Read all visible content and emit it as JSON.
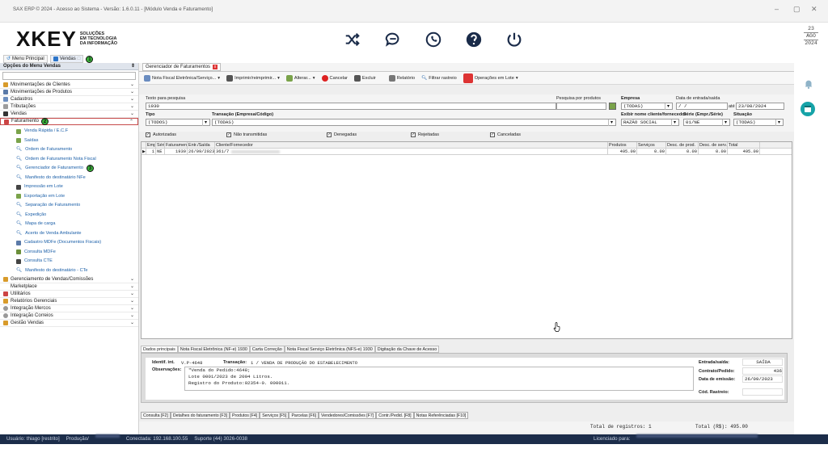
{
  "window": {
    "title": "SAX ERP © 2024 - Acesso ao Sistema - Versão: 1.6.0.11 - [Módulo Venda e Faturamento]",
    "controls": [
      "–",
      "▢",
      "✕"
    ]
  },
  "logo": {
    "mark": "XKEY",
    "tag_line1": "SOLUÇÕES",
    "tag_line2": "EM TECNOLOGIA",
    "tag_line3": "DA INFORMAÇÃO"
  },
  "header_icons": [
    "shuffle-icon",
    "chat-icon",
    "whatsapp-icon",
    "help-icon",
    "power-icon"
  ],
  "date": {
    "day": "23",
    "month": "AGO",
    "year": "2024"
  },
  "tabs": {
    "main_menu": "Menu Principal",
    "vendas": "Vendas",
    "badge": "1"
  },
  "sidebar": {
    "title": "Opções do Menu Vendas",
    "items": [
      {
        "label": "Movimentações de Clientes"
      },
      {
        "label": "Movimentações de Produtos"
      },
      {
        "label": "Cadastros"
      },
      {
        "label": "Tributações"
      },
      {
        "label": "Vendas"
      },
      {
        "label": "Faturamento",
        "badge": "2"
      }
    ],
    "subitems": [
      "Venda Rápida / E.C.F",
      "Saídas",
      "Ordem de Faturamento",
      "Ordem de Faturamento Nota Fiscal",
      "Gerenciador de Faturamento",
      "Manifesto do destinatário NFe",
      "Impressão em Lote",
      "Exportação em Lote",
      "Separação de Faturamento",
      "Expedição",
      "Mapa de carga",
      "Acerto de Venda Ambulante",
      "Cadastro MDFe (Documentos Fiscais)",
      "Consulta MDFe",
      "Consulta CTE",
      "Manifesto do destinatário - CTe"
    ],
    "sub_badge": "3",
    "items_after": [
      "Gerenciamento de Vendas/Comissões",
      "Marketplace",
      "Utilitários",
      "Relatórios Gerenciais",
      "Integração Mercos",
      "Integração Correios",
      "Gestão Vendas"
    ]
  },
  "main_tab": "Gerenciador de Faturamentos",
  "toolbar": {
    "nfe": "Nota Fiscal Eletrônica/Serviço...",
    "print": "Imprimir/reimprimir...",
    "alter": "Alterar...",
    "cancel": "Cancelar",
    "delete": "Excluir",
    "report": "Relatório",
    "filter": "Filtrar rastreio",
    "batch": "Operações em Lote"
  },
  "form": {
    "search_label": "Texto para pesquisa",
    "search_value": "1930",
    "product_label": "Pesquisa por produtos",
    "company_label": "Empresa",
    "company_value": "(TODAS)",
    "date_label": "Data de entrada/saída",
    "date_from": "/ /",
    "date_to_label": "até",
    "date_to": "23/08/2024",
    "type_label": "Tipo",
    "type_value": "(TODOS)",
    "transaction_label": "Transação (Empresa/Código)",
    "transaction_value": "(TODAS)",
    "show_name_label": "Exibir nome cliente/fornecedor",
    "show_name_value": "RAZÃO SOCIAL",
    "series_label": "Série (Empr./Série)",
    "series_value": "01/NE",
    "status_label": "Situação",
    "status_value": "(TODAS)",
    "checks": [
      {
        "label": "Autorizadas",
        "checked": "✓"
      },
      {
        "label": "Não transmitidas",
        "checked": "✓"
      },
      {
        "label": "Denegadas",
        "checked": "✓"
      },
      {
        "label": "Rejeitadas",
        "checked": "✓"
      },
      {
        "label": "Canceladas",
        "checked": "✓"
      }
    ]
  },
  "grid": {
    "headers": [
      "Emp.",
      "Série",
      "Faturamento",
      "Entr./Saída",
      "Cliente/Fornecedor",
      "Produtos",
      "Serviços",
      "Desc. de prod.",
      "Desc. de serv.",
      "Total"
    ],
    "row": {
      "emp": "1",
      "serie": "NE",
      "fat": "1930",
      "date": "26/09/2023",
      "client": "361/7",
      "produtos": "495.00",
      "servicos": "0.00",
      "descp": "0.00",
      "descs": "0.00",
      "total": "495.00"
    }
  },
  "detail_tabs": [
    "Dados principais",
    "Nota Fiscal Eletrônica (NF-e) 1930",
    "Carta Correção",
    "Nota Fiscal Serviço Eletrônica (NFS-e) 1930",
    "Digitação da Chave de Acesso"
  ],
  "details": {
    "ident_label": "Identif. int.",
    "ident_value": "V.P-4648",
    "trans_label": "Transação:",
    "trans_value": "1 / VENDA DE PRODUÇÃO DO ESTABELECIMENTO",
    "obs_label": "Observações:",
    "obs_line1": "\"Venda do Pedido:4648;",
    "obs_line2": "Lote 0001/2023 de 2004 Litros.",
    "obs_line3": "Registro do Produto:02354-0. 000011.",
    "entry_label": "Entrada/saída:",
    "entry_value": "SAÍDA",
    "contract_label": "Contrato/Pedido:",
    "contract_value": "436",
    "emission_label": "Data de emissão:",
    "emission_value": "26/09/2023",
    "tracking_label": "Cód. Rastreio:"
  },
  "bottom_tabs": [
    "Consulta [F2]",
    "Detalhes do faturamento [F3]",
    "Produtos [F4]",
    "Serviços [F5]",
    "Parcelas [F6]",
    "Vendedores/Comissões [F7]",
    "Contr./Pedid. [F8]",
    "Notas Referênciadas [F10]"
  ],
  "totals": {
    "records": "Total de registros: 1",
    "total": "Total (R$): 495.00"
  },
  "status": {
    "user": "Usuário: thiago [restrito]",
    "prod": "Produção/",
    "conn": "Conectada: 192.168.100.55",
    "support": "Suporte (44) 3026-0038",
    "licensed": "Licenciado para:"
  },
  "colors": {
    "accent": "#1b5fa8",
    "status_bg": "#1c2d4a",
    "badge_green": "#3bb53b",
    "calendar": "#16a3a8"
  }
}
